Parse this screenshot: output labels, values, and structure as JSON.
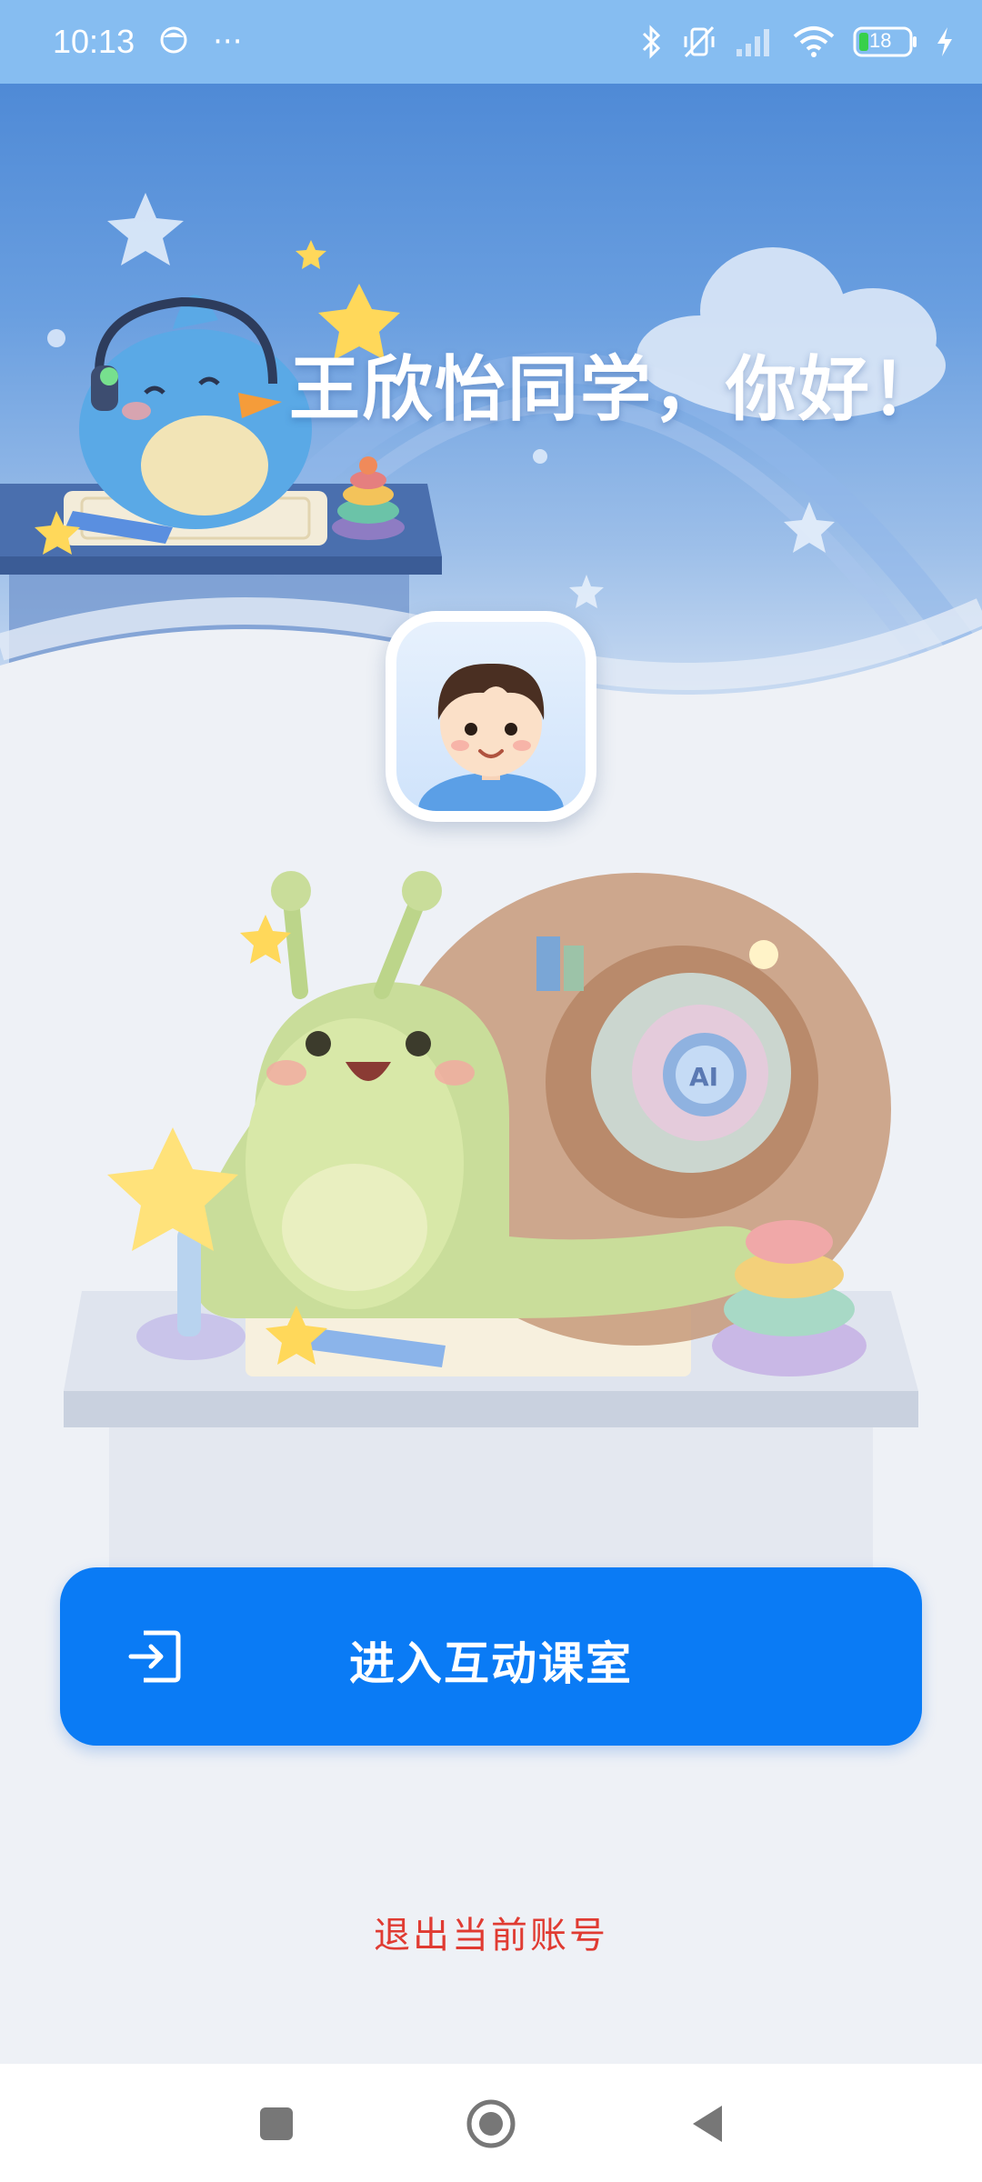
{
  "status_bar": {
    "time": "10:13",
    "more": "···",
    "battery_level": "18",
    "icons": [
      "notification-face-icon",
      "bluetooth-icon",
      "vibrate-off-icon",
      "signal-icon",
      "wifi-icon",
      "battery-icon",
      "charging-icon"
    ]
  },
  "hero": {
    "greeting": "王欣怡同学，你好！"
  },
  "main": {
    "enter_button_label": "进入互动课室",
    "logout_label": "退出当前账号"
  },
  "colors": {
    "primary_button": "#0a7bf5",
    "logout_text": "#e03b32",
    "status_bar": "#86bdf1"
  },
  "nav": {
    "icons": [
      "recent-apps-icon",
      "home-icon",
      "back-icon"
    ]
  }
}
